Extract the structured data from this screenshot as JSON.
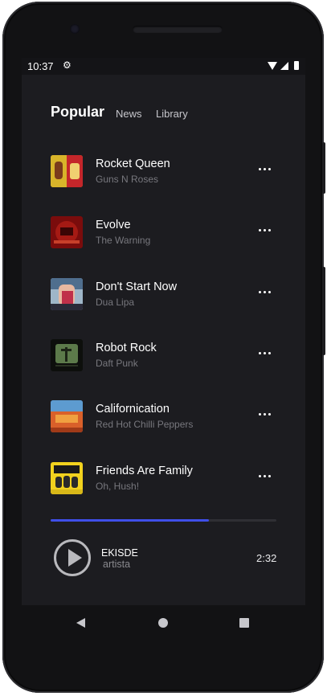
{
  "status_bar": {
    "time": "10:37",
    "icons": [
      "settings-icon",
      "wifi-icon",
      "signal-icon",
      "battery-icon"
    ]
  },
  "tabs": [
    {
      "label": "Popular",
      "active": true
    },
    {
      "label": "News",
      "active": false
    },
    {
      "label": "Library",
      "active": false
    }
  ],
  "tracks": [
    {
      "title": "Rocket Queen",
      "artist": "Guns N Roses",
      "more_icon": "more-horizontal-icon"
    },
    {
      "title": "Evolve",
      "artist": "The Warning",
      "more_icon": "more-horizontal-icon"
    },
    {
      "title": "Don't Start Now",
      "artist": "Dua Lipa",
      "more_icon": "more-horizontal-icon"
    },
    {
      "title": "Robot Rock",
      "artist": "Daft Punk",
      "more_icon": "more-horizontal-icon"
    },
    {
      "title": "Californication",
      "artist": "Red Hot Chilli Peppers",
      "more_icon": "more-horizontal-icon"
    },
    {
      "title": "Friends Are Family",
      "artist": "Oh, Hush!",
      "more_icon": "more-horizontal-icon"
    }
  ],
  "now_playing": {
    "title": "EKISDE",
    "artist": "artista",
    "time": "2:32",
    "progress": 0.7,
    "play_icon": "play-circle-icon"
  },
  "nav_bar": {
    "icons": [
      "back-icon",
      "home-icon",
      "recents-icon"
    ]
  },
  "colors": {
    "background": "#1c1c20",
    "accent": "#3f4fe8",
    "text_primary": "#ffffff",
    "text_secondary": "#77777d"
  }
}
